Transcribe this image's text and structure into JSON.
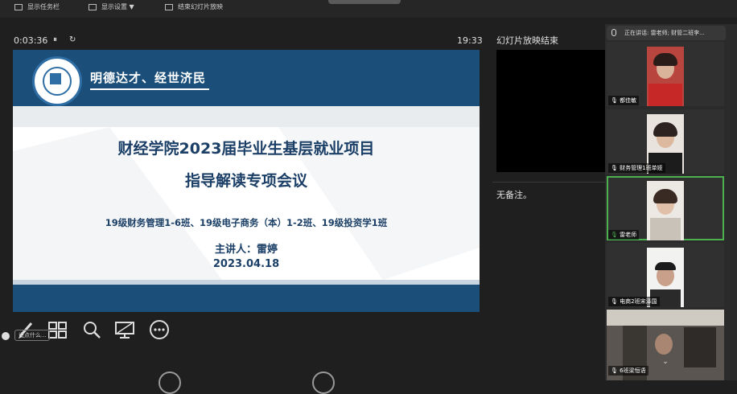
{
  "toolbar": {
    "show_taskbar": "显示任务栏",
    "display_settings": "显示设置 ▼",
    "end_show": "结束幻灯片放映"
  },
  "presenter": {
    "elapsed": "0:03:36",
    "clock": "19:33",
    "pause_glyph": "⏸",
    "reset_glyph": "↻",
    "next_slide_label": "幻灯片放映结束",
    "notes": "无备注。"
  },
  "slide": {
    "motto": "明德达才、经世济民",
    "title_line1": "财经学院2023届毕业生基层就业项目",
    "title_line2": "指导解读专项会议",
    "classes": "19级财务管理1-6班、19级电子商务（本）1-2班、19级投资学1班",
    "speaker": "主讲人：雷婷",
    "date": "2023.04.18"
  },
  "chat": {
    "placeholder": "说点什么..."
  },
  "video_panel": {
    "speaking_now": "正在讲话: 雷老师; 财管二班李...",
    "participants": [
      {
        "name": "都佳敏",
        "mic": "muted"
      },
      {
        "name": "财务管理1班单娅",
        "mic": "muted"
      },
      {
        "name": "雷老师",
        "mic": "active"
      },
      {
        "name": "电商2班宋泽国",
        "mic": "muted"
      },
      {
        "name": "6班梁恒语",
        "mic": "muted"
      }
    ]
  },
  "colors": {
    "slide_blue": "#1b4f7a",
    "title_navy": "#1b3f66",
    "active_speaker": "#4caf50"
  }
}
